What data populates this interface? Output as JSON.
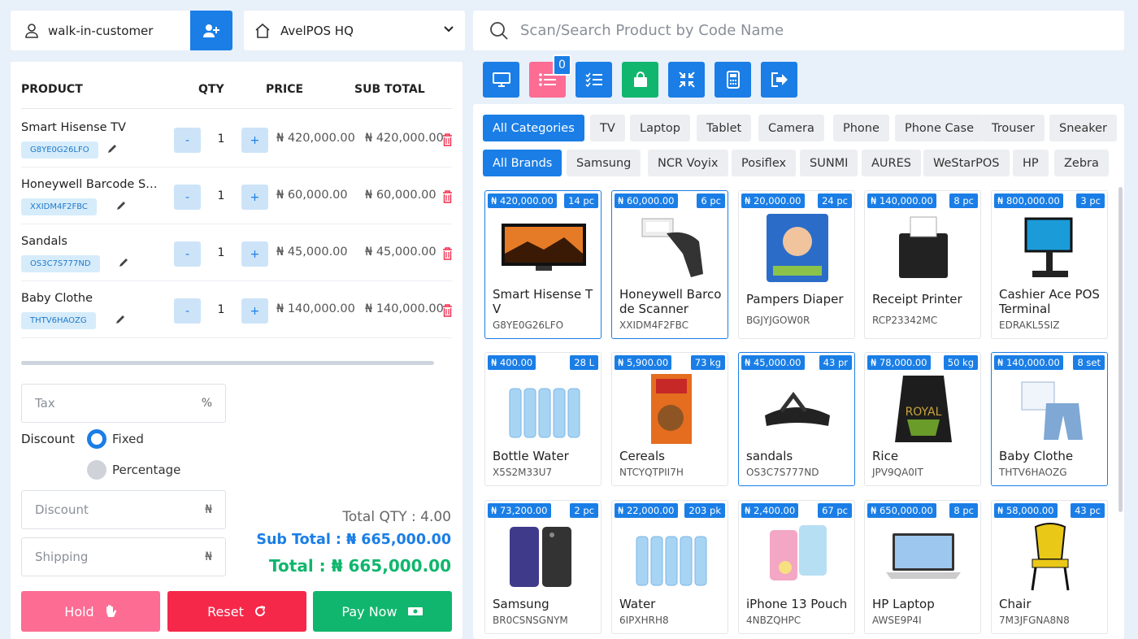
{
  "top": {
    "customer": "walk-in-customer",
    "warehouse": "AvelPOS HQ",
    "search_placeholder": "Scan/Search Product by Code Name"
  },
  "cart": {
    "headers": {
      "product": "PRODUCT",
      "qty": "QTY",
      "price": "PRICE",
      "subtotal": "SUB TOTAL"
    },
    "items": [
      {
        "name": "Smart Hisense TV",
        "code": "G8YE0G26LFO",
        "qty": "1",
        "price": "₦ 420,000.00",
        "subtotal": "₦ 420,000.00"
      },
      {
        "name": "Honeywell Barcode Scanner",
        "code": "XXIDM4F2FBC",
        "qty": "1",
        "price": "₦ 60,000.00",
        "subtotal": "₦ 60,000.00"
      },
      {
        "name": "Sandals",
        "code": "OS3C7S777ND",
        "qty": "1",
        "price": "₦ 45,000.00",
        "subtotal": "₦ 45,000.00"
      },
      {
        "name": "Baby Clothe",
        "code": "THTV6HAOZG",
        "qty": "1",
        "price": "₦ 140,000.00",
        "subtotal": "₦ 140,000.00"
      }
    ],
    "minus_label": "-",
    "plus_label": "+"
  },
  "form": {
    "tax_placeholder": "Tax",
    "tax_suffix": "%",
    "discount_label": "Discount",
    "fixed_label": "Fixed",
    "percentage_label": "Percentage",
    "discount_placeholder": "Discount",
    "discount_suffix": "₦",
    "shipping_placeholder": "Shipping",
    "shipping_suffix": "₦"
  },
  "totals": {
    "qty": "Total QTY : 4.00",
    "subtotal": "Sub Total : ₦ 665,000.00",
    "total": "Total : ₦ 665,000.00"
  },
  "actions": {
    "hold": "Hold",
    "reset": "Reset",
    "pay": "Pay Now"
  },
  "toolbar": {
    "badge_count": "0"
  },
  "categories": [
    "All Categories",
    "TV",
    "Laptop",
    "Tablet",
    "Camera",
    "Phone",
    "Phone Case",
    "Trouser",
    "Sneaker"
  ],
  "brands": [
    "All Brands",
    "Samsung",
    "NCR Voyix",
    "Posiflex",
    "SUNMI",
    "AURES",
    "WeStarPOS",
    "HP",
    "Zebra"
  ],
  "products": [
    {
      "price": "₦ 420,000.00",
      "stock": "14 pc",
      "name": "Smart Hisense TV",
      "code": "G8YE0G26LFO",
      "img": "tv"
    },
    {
      "price": "₦ 60,000.00",
      "stock": "6 pc",
      "name": "Honeywell Barcode Scanner",
      "code": "XXIDM4F2FBC",
      "img": "scanner"
    },
    {
      "price": "₦ 20,000.00",
      "stock": "24 pc",
      "name": "Pampers Diaper",
      "code": "BGJYJGOW0R",
      "img": "diaper"
    },
    {
      "price": "₦ 140,000.00",
      "stock": "8 pc",
      "name": "Receipt Printer",
      "code": "RCP23342MC",
      "img": "printer"
    },
    {
      "price": "₦ 800,000.00",
      "stock": "3 pc",
      "name": "Cashier Ace POS Terminal",
      "code": "EDRAKL5SIZ",
      "img": "terminal"
    },
    {
      "price": "₦ 400.00",
      "stock": "28 L",
      "name": "Bottle Water",
      "code": "X5S2M33U7",
      "img": "water"
    },
    {
      "price": "₦ 5,900.00",
      "stock": "73 kg",
      "name": "Cereals",
      "code": "NTCYQTPII7H",
      "img": "cereal"
    },
    {
      "price": "₦ 45,000.00",
      "stock": "43 pr",
      "name": "sandals",
      "code": "OS3C7S777ND",
      "img": "sandal"
    },
    {
      "price": "₦ 78,000.00",
      "stock": "50 kg",
      "name": "Rice",
      "code": "JPV9QA0IT",
      "img": "rice"
    },
    {
      "price": "₦ 140,000.00",
      "stock": "8 set",
      "name": "Baby Clothe",
      "code": "THTV6HAOZG",
      "img": "clothe"
    },
    {
      "price": "₦ 73,200.00",
      "stock": "2 pc",
      "name": "Samsung",
      "code": "BR0CSNSGNYM",
      "img": "phone"
    },
    {
      "price": "₦ 22,000.00",
      "stock": "203 pk",
      "name": "Water",
      "code": "6IPXHRH8",
      "img": "water"
    },
    {
      "price": "₦ 2,400.00",
      "stock": "67 pc",
      "name": "iPhone 13 Pouch",
      "code": "4NBZQHPC",
      "img": "pouch"
    },
    {
      "price": "₦ 650,000.00",
      "stock": "8 pc",
      "name": "HP Laptop",
      "code": "AWSE9P4I",
      "img": "laptop"
    },
    {
      "price": "₦ 58,000.00",
      "stock": "43 pc",
      "name": "Chair",
      "code": "7M3JFGNA8N8",
      "img": "chair"
    }
  ],
  "colors": {
    "primary": "#1a7ee6",
    "hold": "#fc6c93",
    "reset": "#f5284a",
    "pay": "#10b66d",
    "price_green": "#10b66d"
  }
}
